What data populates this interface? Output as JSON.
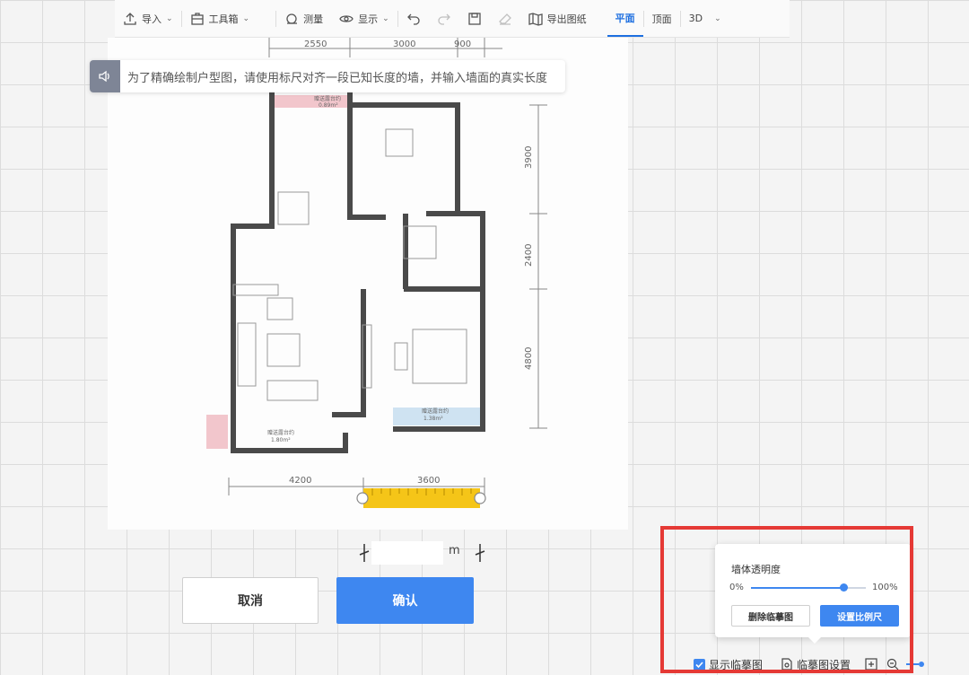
{
  "toolbar": {
    "import": "导入",
    "toolbox": "工具箱",
    "measure": "测量",
    "display": "显示",
    "export": "导出图纸",
    "tab_plan": "平面",
    "tab_ceiling": "顶面",
    "tab_3d": "3D"
  },
  "tip": {
    "text": "为了精确绘制户型图，请使用标尺对齐一段已知长度的墙，并输入墙面的真实长度"
  },
  "dims": {
    "top": [
      "2550",
      "3000",
      "900"
    ],
    "right": [
      "3900",
      "2400",
      "4800"
    ],
    "bottom": [
      "4200",
      "3600"
    ]
  },
  "rooms": {
    "balcony1": "赠送露台约",
    "balcony1_area": "0.89m²",
    "balcony2": "赠送露台约",
    "balcony2_area": "1.38m²",
    "balcony3": "赠送露台约",
    "balcony3_area": "1.80m²"
  },
  "length": {
    "value": "",
    "unit": "m"
  },
  "buttons": {
    "cancel": "取消",
    "confirm": "确认"
  },
  "popup": {
    "title": "墙体透明度",
    "min": "0%",
    "max": "100%",
    "slider_value_percent": 80,
    "delete": "删除临摹图",
    "set_scale": "设置比例尺"
  },
  "bottombar": {
    "show_trace": "显示临摹图",
    "trace_settings": "临摹图设置"
  },
  "colors": {
    "accent": "#3e87f0",
    "highlight": "#e53935",
    "ruler": "#f5c518"
  }
}
